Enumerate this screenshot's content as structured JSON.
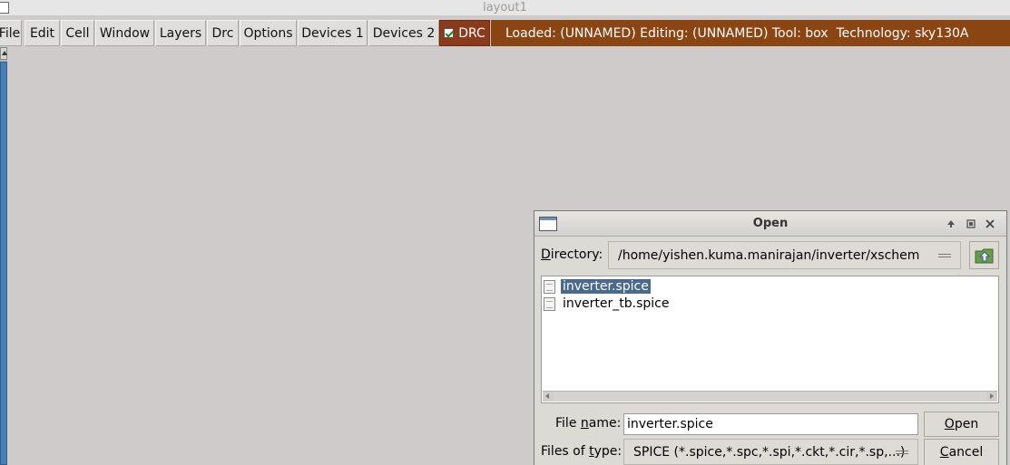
{
  "window": {
    "title": "layout1"
  },
  "menubar": {
    "items": [
      {
        "label": "File"
      },
      {
        "label": "Edit"
      },
      {
        "label": "Cell"
      },
      {
        "label": "Window"
      },
      {
        "label": "Layers"
      },
      {
        "label": "Drc"
      },
      {
        "label": "Options"
      },
      {
        "label": "Devices 1"
      },
      {
        "label": "Devices 2"
      }
    ],
    "drc": {
      "label": "DRC",
      "checked": true
    }
  },
  "status": {
    "text": "Loaded: (UNNAMED) Editing: (UNNAMED) Tool: box  Technology: sky130A"
  },
  "dialog": {
    "title": "Open",
    "directory_label_u": "D",
    "directory_label_rest": "irectory:",
    "directory_value": "/home/yishen.kuma.manirajan/inverter/xschem",
    "files": [
      {
        "name": "inverter.spice",
        "selected": true
      },
      {
        "name": "inverter_tb.spice",
        "selected": false
      }
    ],
    "file_name_label_pre": "File ",
    "file_name_label_u": "n",
    "file_name_label_post": "ame:",
    "file_name_value": "inverter.spice",
    "file_type_label_pre": "Files of ",
    "file_type_label_u": "t",
    "file_type_label_post": "ype:",
    "file_type_value": "SPICE (*.spice,*.spc,*.spi,*.ckt,*.cir,*.sp,...)",
    "open_label_u": "O",
    "open_label_rest": "pen",
    "cancel_label_u": "C",
    "cancel_label_rest": "ancel"
  }
}
